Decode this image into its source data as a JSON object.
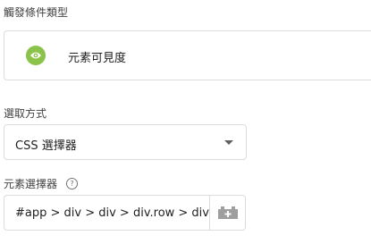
{
  "trigger_type": {
    "label": "觸發條件類型",
    "name": "元素可見度",
    "icon": "eye-icon",
    "icon_color": "#8bc34a"
  },
  "selection_method": {
    "label": "選取方式",
    "value": "CSS 選擇器"
  },
  "element_selector": {
    "label": "元素選擇器",
    "help_icon": "?",
    "value": "#app > div > div > div.row > div > the",
    "variable_icon": "variable-brick-icon"
  }
}
